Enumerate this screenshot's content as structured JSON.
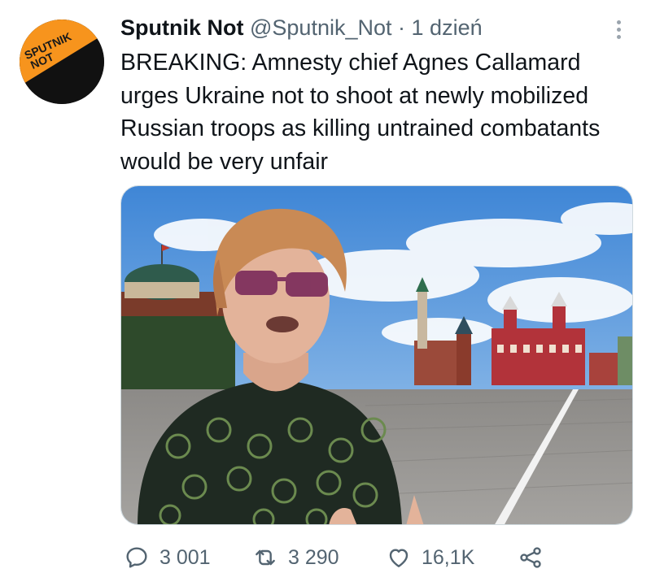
{
  "tweet": {
    "display_name": "Sputnik Not",
    "handle": "@Sputnik_Not",
    "separator": "·",
    "time": "1 dzień",
    "text": "BREAKING: Amnesty chief Agnes Callamard urges Ukraine not to shoot at newly mobilized Russian troops as killing untrained combatants would be very unfair",
    "avatar_logo_text": [
      "SPUTNIK",
      "NOT"
    ]
  },
  "actions": {
    "reply_count": "3 001",
    "retweet_count": "3 290",
    "like_count": "16,1K"
  },
  "icons": {
    "reply": "reply-icon",
    "retweet": "retweet-icon",
    "like": "heart-icon",
    "share": "share-icon",
    "more": "more-dots-icon"
  },
  "colors": {
    "brand_orange": "#f7941d",
    "text_primary": "#0f1419",
    "text_secondary": "#536471"
  }
}
